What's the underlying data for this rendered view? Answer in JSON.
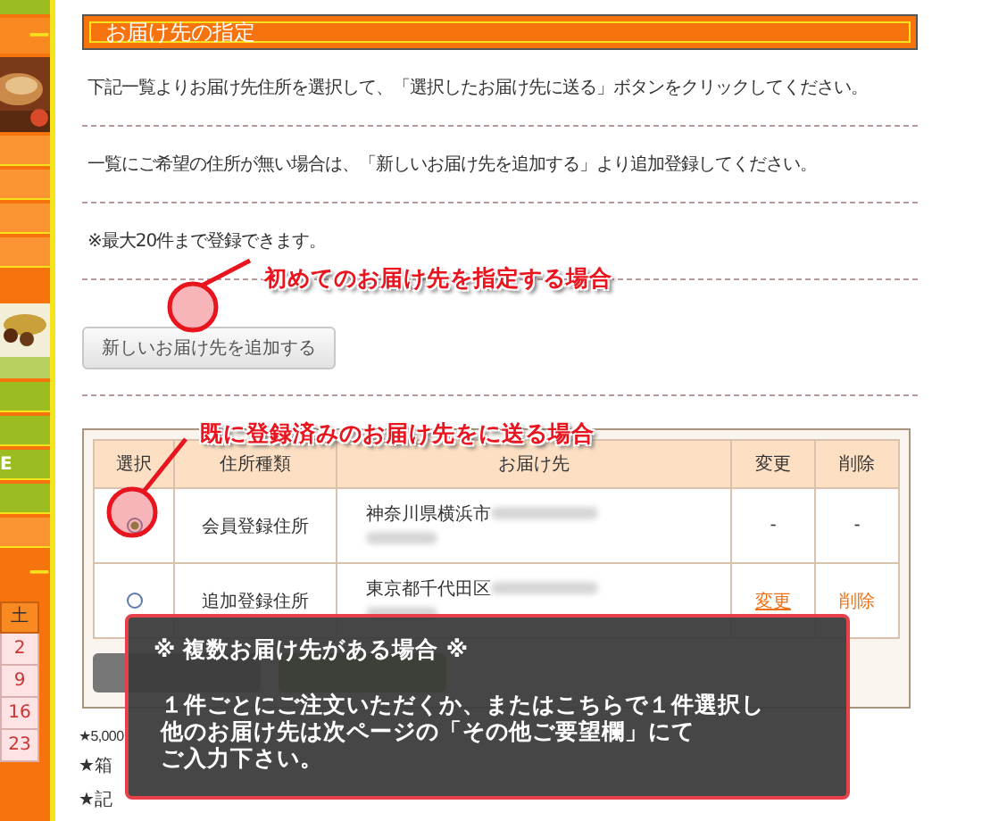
{
  "sidebar": {
    "heading": "ー",
    "menu_label": "E",
    "footer_heading": "ー",
    "calendar": {
      "header": "土",
      "days": [
        "2",
        "9",
        "16",
        "23"
      ]
    }
  },
  "section_title": "お届け先の指定",
  "instructions": [
    "下記一覧よりお届け先住所を選択して、「選択したお届け先に送る」ボタンをクリックしてください。",
    "一覧にご希望の住所が無い場合は、「新しいお届け先を追加する」より追加登録してください。",
    "※最大20件まで登録できます。"
  ],
  "add_button": "新しいお届け先を追加する",
  "table": {
    "columns": [
      "選択",
      "住所種類",
      "お届け先",
      "変更",
      "削除"
    ],
    "rows": [
      {
        "selected": true,
        "type": "会員登録住所",
        "address": "神奈川県横浜市",
        "edit": "-",
        "delete": "-",
        "link": false
      },
      {
        "selected": false,
        "type": "追加登録住所",
        "address": "東京都千代田区",
        "edit": "変更",
        "delete": "削除",
        "link": true
      }
    ]
  },
  "notes": [
    "★5,000",
    "★箱",
    "★記"
  ],
  "callouts": [
    {
      "text": "初めてのお届け先を指定する場合"
    },
    {
      "text": "既に登録済みのお届け先をに送る場合"
    }
  ],
  "popup": {
    "title": "※ 複数お届け先がある場合 ※",
    "lines": [
      "１件ごとにご注文いただくか、またはこちらで１件選択し",
      "他のお届け先は次ページの「その他ご要望欄」にて",
      "ご入力下さい。"
    ]
  }
}
